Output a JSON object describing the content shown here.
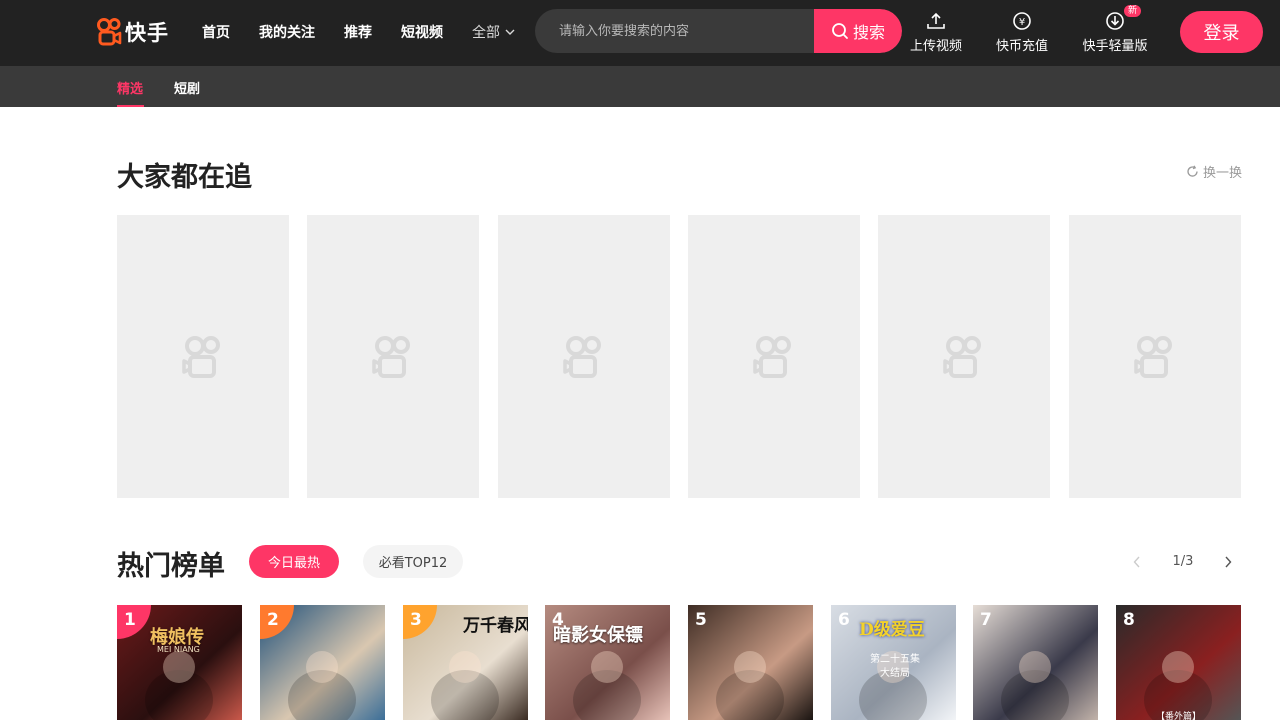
{
  "header": {
    "logo_text": "快手",
    "nav": [
      "首页",
      "我的关注",
      "推荐",
      "短视频",
      "全部"
    ],
    "search": {
      "placeholder": "请输入你要搜索的内容",
      "button_label": "搜索"
    },
    "tools": {
      "upload": "上传视频",
      "recharge": "快币充值",
      "lite": "快手轻量版",
      "lite_badge": "新"
    },
    "login": "登录"
  },
  "subnav": {
    "tabs": [
      "精选",
      "短剧"
    ],
    "active": "精选"
  },
  "trending": {
    "title": "大家都在追",
    "refresh_label": "换一换",
    "placeholder_count": 6
  },
  "hot_list": {
    "title": "热门榜单",
    "filters": [
      "今日最热",
      "必看TOP12"
    ],
    "page_indicator": "1/3",
    "items": [
      {
        "rank": "1",
        "poster_text": "梅娘传",
        "poster_sub": "MEI NIANG",
        "rank_color": "#fe3666"
      },
      {
        "rank": "2",
        "poster_text": "",
        "poster_sub": "",
        "rank_color": "#ff7a2e"
      },
      {
        "rank": "3",
        "poster_text": "万千春风",
        "poster_sub": "",
        "rank_color": "#ffa32e"
      },
      {
        "rank": "4",
        "poster_text": "暗影女保镖",
        "poster_sub": "",
        "rank_color": "transparent"
      },
      {
        "rank": "5",
        "poster_text": "",
        "poster_sub": "",
        "rank_color": "transparent"
      },
      {
        "rank": "6",
        "poster_text": "D级爱豆",
        "poster_sub": "第二十五集 大结局",
        "rank_color": "transparent"
      },
      {
        "rank": "7",
        "poster_text": "",
        "poster_sub": "",
        "rank_color": "transparent"
      },
      {
        "rank": "8",
        "poster_text": "",
        "poster_sub": "【番外篇】",
        "rank_color": "transparent"
      }
    ]
  },
  "colors": {
    "accent": "#fe3666",
    "header_bg": "#222222",
    "subnav_bg": "#3a3a3a",
    "placeholder_bg": "#efefef"
  }
}
